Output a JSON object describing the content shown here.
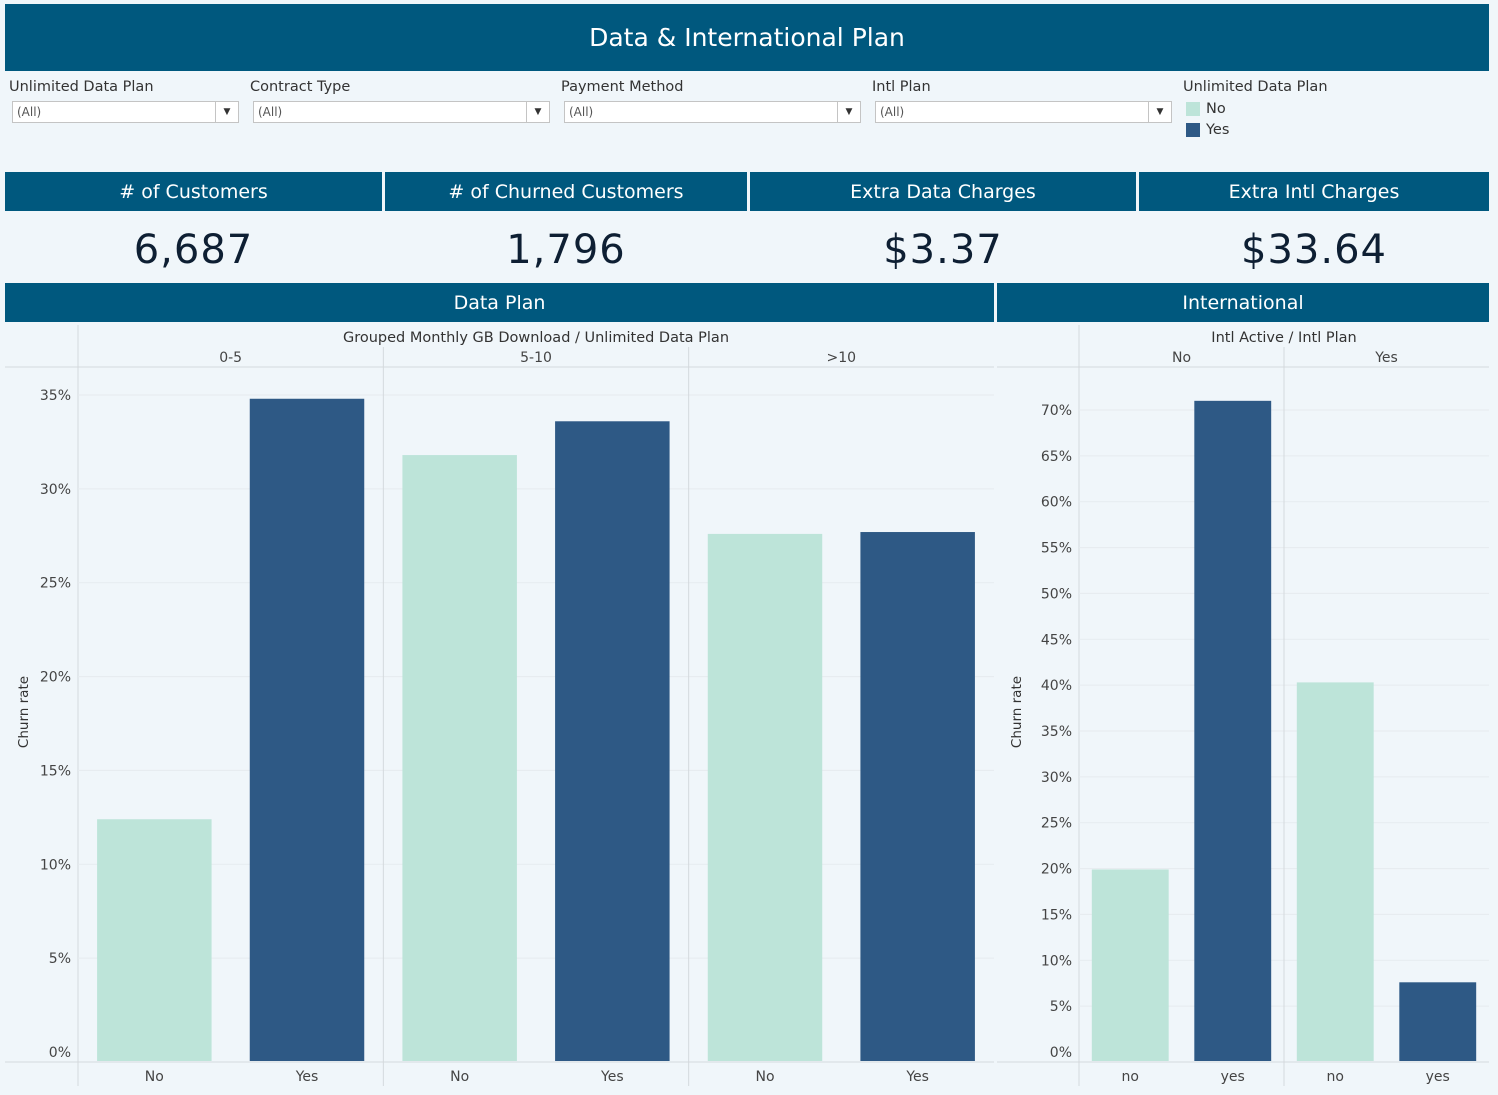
{
  "title": "Data & International Plan",
  "filters": [
    {
      "label": "Unlimited Data Plan",
      "value": "(All)"
    },
    {
      "label": "Contract Type",
      "value": "(All)"
    },
    {
      "label": "Payment Method",
      "value": "(All)"
    },
    {
      "label": "Intl Plan",
      "value": "(All)"
    }
  ],
  "legend": {
    "title": "Unlimited Data Plan",
    "items": [
      {
        "label": "No",
        "color": "#bde4d9"
      },
      {
        "label": "Yes",
        "color": "#2e5985"
      }
    ]
  },
  "kpis": [
    {
      "label": "# of Customers",
      "value": "6,687"
    },
    {
      "label": "# of Churned Customers",
      "value": "1,796"
    },
    {
      "label": "Extra Data Charges",
      "value": "$3.37"
    },
    {
      "label": "Extra Intl Charges",
      "value": "$33.64"
    }
  ],
  "sections": {
    "data_plan": "Data Plan",
    "international": "International"
  },
  "chart_data": [
    {
      "type": "bar",
      "title": "Data Plan",
      "header": "Grouped Monthly GB Download  /  Unlimited Data Plan",
      "ylabel": "Churn rate",
      "ylim": [
        0,
        0.35
      ],
      "yticks": [
        0,
        0.05,
        0.1,
        0.15,
        0.2,
        0.25,
        0.3,
        0.35
      ],
      "ytick_labels": [
        "0%",
        "5%",
        "10%",
        "15%",
        "20%",
        "25%",
        "30%",
        "35%"
      ],
      "groups": [
        "0-5",
        "5-10",
        ">10"
      ],
      "categories": [
        "No",
        "Yes"
      ],
      "colors": {
        "No": "#bde4d9",
        "Yes": "#2e5985"
      },
      "values": [
        [
          0.124,
          0.348
        ],
        [
          0.318,
          0.336
        ],
        [
          0.276,
          0.277
        ]
      ],
      "grid": true
    },
    {
      "type": "bar",
      "title": "International",
      "header": "Intl Active  /  Intl Plan",
      "ylabel": "Churn rate",
      "ylim": [
        0,
        0.73
      ],
      "yticks": [
        0,
        0.05,
        0.1,
        0.15,
        0.2,
        0.25,
        0.3,
        0.35,
        0.4,
        0.45,
        0.5,
        0.55,
        0.6,
        0.65,
        0.7
      ],
      "ytick_labels": [
        "0%",
        "5%",
        "10%",
        "15%",
        "20%",
        "25%",
        "30%",
        "35%",
        "40%",
        "45%",
        "50%",
        "55%",
        "60%",
        "65%",
        "70%"
      ],
      "groups": [
        "No",
        "Yes"
      ],
      "categories": [
        "no",
        "yes"
      ],
      "colors": {
        "no": "#bde4d9",
        "yes": "#2e5985"
      },
      "values": [
        [
          0.199,
          0.71
        ],
        [
          0.403,
          0.076
        ]
      ],
      "grid": true
    }
  ]
}
